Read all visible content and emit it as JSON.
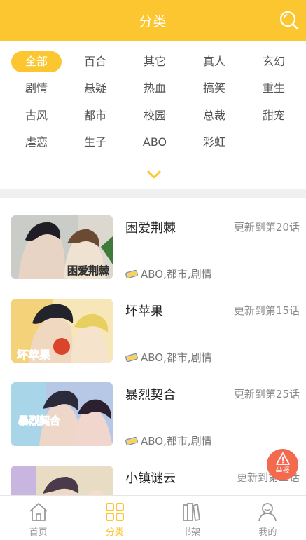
{
  "header": {
    "title": "分类",
    "search_icon": "search-icon"
  },
  "filters": {
    "rows": [
      [
        "全部",
        "百合",
        "其它",
        "真人",
        "玄幻"
      ],
      [
        "剧情",
        "悬疑",
        "热血",
        "搞笑",
        "重生"
      ],
      [
        "古风",
        "都市",
        "校园",
        "总裁",
        "甜宠"
      ],
      [
        "虐恋",
        "生子",
        "ABO",
        "彩虹"
      ]
    ],
    "active": "全部",
    "expand_icon": "chevron-down-icon"
  },
  "comics": [
    {
      "title": "困爱荆棘",
      "update": "更新到第20话",
      "tags": "ABO,都市,剧情",
      "cover_text": "困爱荆棘"
    },
    {
      "title": "坏苹果",
      "update": "更新到第15话",
      "tags": "ABO,都市,剧情",
      "cover_text": "坏苹果"
    },
    {
      "title": "暴烈契合",
      "update": "更新到第25话",
      "tags": "ABO,都市,剧情",
      "cover_text": "暴烈契合"
    },
    {
      "title": "小镇谜云",
      "update": "更新到第二话",
      "tags": "",
      "cover_text": ""
    }
  ],
  "report": {
    "label": "举报",
    "icon": "warning-icon"
  },
  "tabbar": {
    "tabs": [
      {
        "label": "首页",
        "icon": "home-icon"
      },
      {
        "label": "分类",
        "icon": "grid-icon"
      },
      {
        "label": "书架",
        "icon": "bookshelf-icon"
      },
      {
        "label": "我的",
        "icon": "profile-icon"
      }
    ],
    "active": "分类"
  },
  "colors": {
    "accent": "#fbc62f",
    "report": "#f36a4f",
    "muted": "#888888"
  }
}
